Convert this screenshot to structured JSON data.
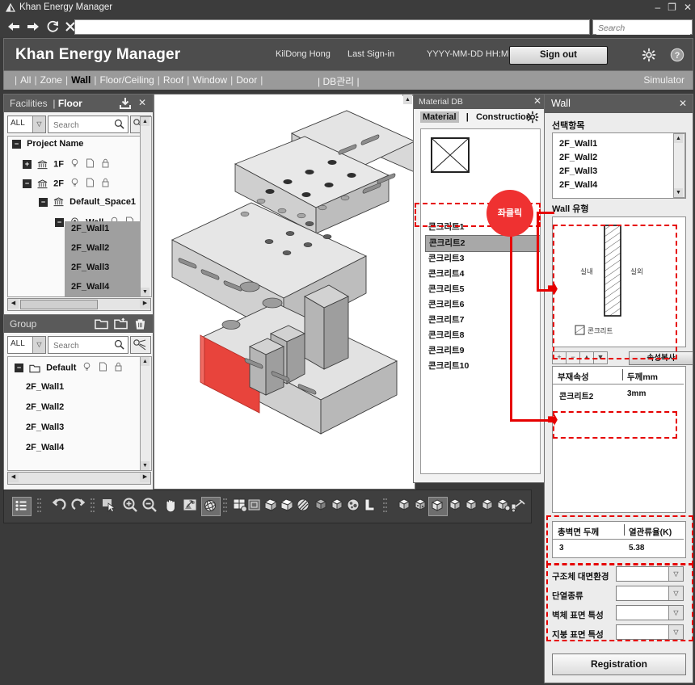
{
  "window": {
    "title": "Khan Energy Manager",
    "app_icon": "app-logo-icon",
    "minimize": "–",
    "maximize": "❐",
    "close": "✕"
  },
  "navbar": {
    "back": "←",
    "forward": "→",
    "reload": "⟳",
    "stop": "✕",
    "address_value": "",
    "search_placeholder": "Search"
  },
  "header": {
    "title": "Khan Energy Manager",
    "user_name": "KilDong Hong",
    "last_signin_label": "Last Sign-in",
    "last_signin_value": "YYYY-MM-DD  HH:MM",
    "signout_label": "Sign out",
    "settings_icon": "gear-icon",
    "help_icon": "help-icon"
  },
  "menu": {
    "items": [
      {
        "label": "All",
        "active": false
      },
      {
        "label": "Zone",
        "active": false
      },
      {
        "label": "Wall",
        "active": true
      },
      {
        "label": "Floor/Ceiling",
        "active": false
      },
      {
        "label": "Roof",
        "active": false
      },
      {
        "label": "Window",
        "active": false
      },
      {
        "label": "Door",
        "active": false
      }
    ],
    "db_label": "| DB관리 |",
    "simulator_label": "Simulator"
  },
  "facilities": {
    "title_prefix": "Facilities",
    "title_sep": "|",
    "title_main": "Floor",
    "download_icon": "download-icon",
    "close_icon": "close-icon",
    "filter_value": "ALL",
    "search_placeholder": "Search",
    "tree": [
      {
        "label": "Project Name",
        "level": 0,
        "toggle": "−",
        "icon": "",
        "badges": false
      },
      {
        "label": "1F",
        "level": 1,
        "toggle": "+",
        "icon": "building-icon",
        "badges": true
      },
      {
        "label": "2F",
        "level": 1,
        "toggle": "−",
        "icon": "building-icon",
        "badges": true
      },
      {
        "label": "Default_Space1",
        "level": 2,
        "toggle": "−",
        "icon": "building-icon",
        "badges": false
      },
      {
        "label": "Wall",
        "level": 3,
        "toggle": "−",
        "icon": "wall-node-icon",
        "badges": true
      }
    ],
    "selected_walls": [
      "2F_Wall1",
      "2F_Wall2",
      "2F_Wall3",
      "2F_Wall4"
    ]
  },
  "group": {
    "title": "Group",
    "new_folder_icon": "new-folder-icon",
    "open_folder_icon": "open-folder-icon",
    "delete_icon": "trash-icon",
    "filter_value": "ALL",
    "search_placeholder": "Search",
    "root_label": "Default",
    "items": [
      "2F_Wall1",
      "2F_Wall2",
      "2F_Wall3",
      "2F_Wall4"
    ]
  },
  "toolbar": {
    "icons": [
      "list-view-icon",
      "grip-icon",
      "undo-icon",
      "redo-icon",
      "grip-icon",
      "select-icon",
      "zoom-in-icon",
      "zoom-out-icon",
      "pan-icon",
      "fit-icon",
      "orbit-icon",
      "grip-icon",
      "grid-settings-icon",
      "grip-icon",
      "box-wire-icon",
      "box-solid-icon",
      "box-shade-icon",
      "box-hatch-icon",
      "box-face-icon",
      "box-edge-icon",
      "box-texture-icon",
      "box-l-icon",
      "grip-icon",
      "layer1-icon",
      "layer2-icon",
      "layer3-icon",
      "layer4-icon",
      "layer5-icon",
      "layer6-icon",
      "layer7-icon",
      "layer8-icon",
      "layer9-icon",
      "camera-icon"
    ],
    "selected_index": 0,
    "selected_index2": 24
  },
  "material_db": {
    "title": "Material DB",
    "close_icon": "close-icon",
    "tab_material": "Material",
    "tab_sep": "|",
    "tab_construction": "Construction",
    "gear_icon": "gear-icon",
    "thumbnail": "no-image-icon",
    "items": [
      "콘크리트1",
      "콘크리트2",
      "콘크리트3",
      "콘크리트4",
      "콘크리트5",
      "콘크리트6",
      "콘크리트7",
      "콘크리트8",
      "콘크리트9",
      "콘크리트10"
    ],
    "selected_item": "콘크리트2"
  },
  "wall_panel": {
    "title": "Wall",
    "close_icon": "close-icon",
    "selected_list_label": "선택항목",
    "selected_items": [
      "2F_Wall1",
      "2F_Wall2",
      "2F_Wall3",
      "2F_Wall4"
    ],
    "wall_type_label": "Wall 유형",
    "diagram_indoor": "실내",
    "diagram_outdoor": "실외",
    "diagram_legend": "콘크리트",
    "row_buttons": [
      "+",
      "−",
      "▲",
      "▼"
    ],
    "copy_props_label": "속성복사",
    "props_table": {
      "headers": [
        "부재속성",
        "두께mm"
      ],
      "rows": [
        [
          "콘크리트2",
          "3mm"
        ]
      ]
    },
    "summary_table": {
      "headers": [
        "총벽면 두께",
        "열관류율(K)"
      ],
      "rows": [
        [
          "3",
          "5.38"
        ]
      ]
    },
    "combos": [
      {
        "label": "구조체 대면환경",
        "value": ""
      },
      {
        "label": "단열종류",
        "value": ""
      },
      {
        "label": "벽체 표면 특성",
        "value": ""
      },
      {
        "label": "지붕 표면 특성",
        "value": ""
      }
    ],
    "registration_label": "Registration"
  },
  "annotation": {
    "bubble_text": "좌클릭",
    "color": "#e60000"
  },
  "colors": {
    "titlebar": "#3c3c3c",
    "header": "#4d4d4d",
    "menustrip": "#9a9a9a",
    "panel_header": "#5a5a5a",
    "accent_red": "#e60000",
    "selection_gray": "#a8a8a8",
    "model_highlight": "#e8443c"
  }
}
